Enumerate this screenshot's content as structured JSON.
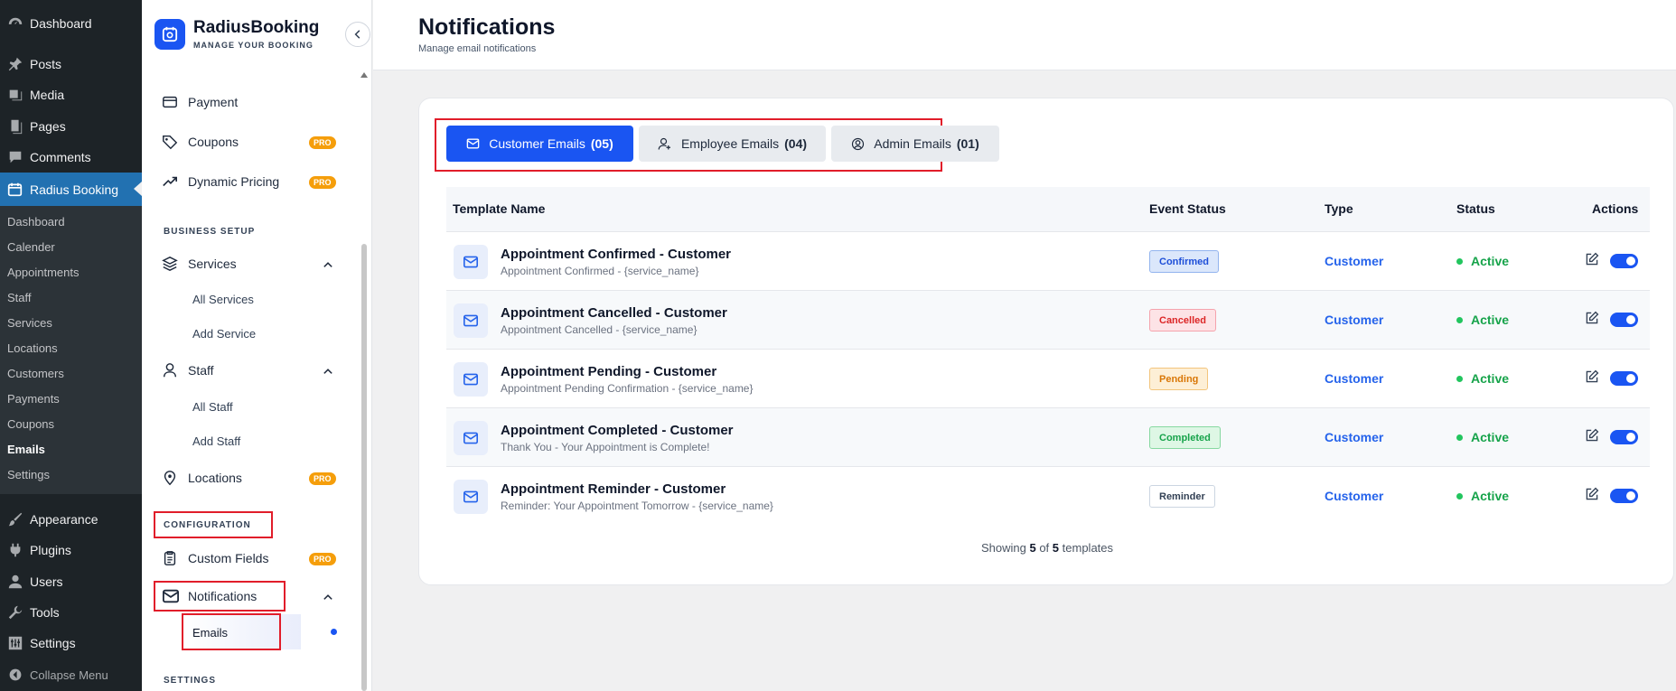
{
  "wp_menu": {
    "dashboard": "Dashboard",
    "posts": "Posts",
    "media": "Media",
    "pages": "Pages",
    "comments": "Comments",
    "radius_booking": "Radius Booking",
    "submenu": [
      "Dashboard",
      "Calender",
      "Appointments",
      "Staff",
      "Services",
      "Locations",
      "Customers",
      "Payments",
      "Coupons",
      "Emails",
      "Settings"
    ],
    "current_submenu": "Emails",
    "appearance": "Appearance",
    "plugins": "Plugins",
    "users": "Users",
    "tools": "Tools",
    "settings": "Settings",
    "collapse": "Collapse Menu"
  },
  "plugin_sidebar": {
    "brand_title": "RadiusBooking",
    "brand_subtitle": "MANAGE YOUR BOOKING",
    "pro_label": "PRO",
    "payment": "Payment",
    "coupons": "Coupons",
    "dynamic_pricing": "Dynamic Pricing",
    "section_business": "BUSINESS SETUP",
    "services": "Services",
    "all_services": "All Services",
    "add_service": "Add Service",
    "staff": "Staff",
    "all_staff": "All Staff",
    "add_staff": "Add Staff",
    "locations": "Locations",
    "section_configuration": "CONFIGURATION",
    "custom_fields": "Custom Fields",
    "notifications": "Notifications",
    "emails": "Emails",
    "section_settings": "SETTINGS"
  },
  "header": {
    "title": "Notifications",
    "subtitle": "Manage email notifications"
  },
  "tabs": [
    {
      "label": "Customer Emails",
      "count": "(05)",
      "icon": "mail-icon"
    },
    {
      "label": "Employee Emails",
      "count": "(04)",
      "icon": "user-plus-icon"
    },
    {
      "label": "Admin Emails",
      "count": "(01)",
      "icon": "user-circle-icon"
    }
  ],
  "table": {
    "columns": [
      "Template Name",
      "Event Status",
      "Type",
      "Status",
      "Actions"
    ],
    "rows": [
      {
        "name": "Appointment Confirmed - Customer",
        "subject": "Appointment Confirmed - {service_name}",
        "event": "Confirmed",
        "type": "Customer",
        "status": "Active"
      },
      {
        "name": "Appointment Cancelled - Customer",
        "subject": "Appointment Cancelled - {service_name}",
        "event": "Cancelled",
        "type": "Customer",
        "status": "Active"
      },
      {
        "name": "Appointment Pending - Customer",
        "subject": "Appointment Pending Confirmation - {service_name}",
        "event": "Pending",
        "type": "Customer",
        "status": "Active"
      },
      {
        "name": "Appointment Completed - Customer",
        "subject": "Thank You - Your Appointment is Complete!",
        "event": "Completed",
        "type": "Customer",
        "status": "Active"
      },
      {
        "name": "Appointment Reminder - Customer",
        "subject": "Reminder: Your Appointment Tomorrow - {service_name}",
        "event": "Reminder",
        "type": "Customer",
        "status": "Active"
      }
    ]
  },
  "footer": {
    "prefix": "Showing",
    "shown": "5",
    "of": "of",
    "total": "5",
    "suffix": "templates"
  },
  "colors": {
    "accent": "#1a55f2",
    "wp_menu_bg": "#1d2327",
    "wp_active": "#2271b1",
    "active_green": "#16a34a",
    "highlight_red": "#e11d2a"
  }
}
